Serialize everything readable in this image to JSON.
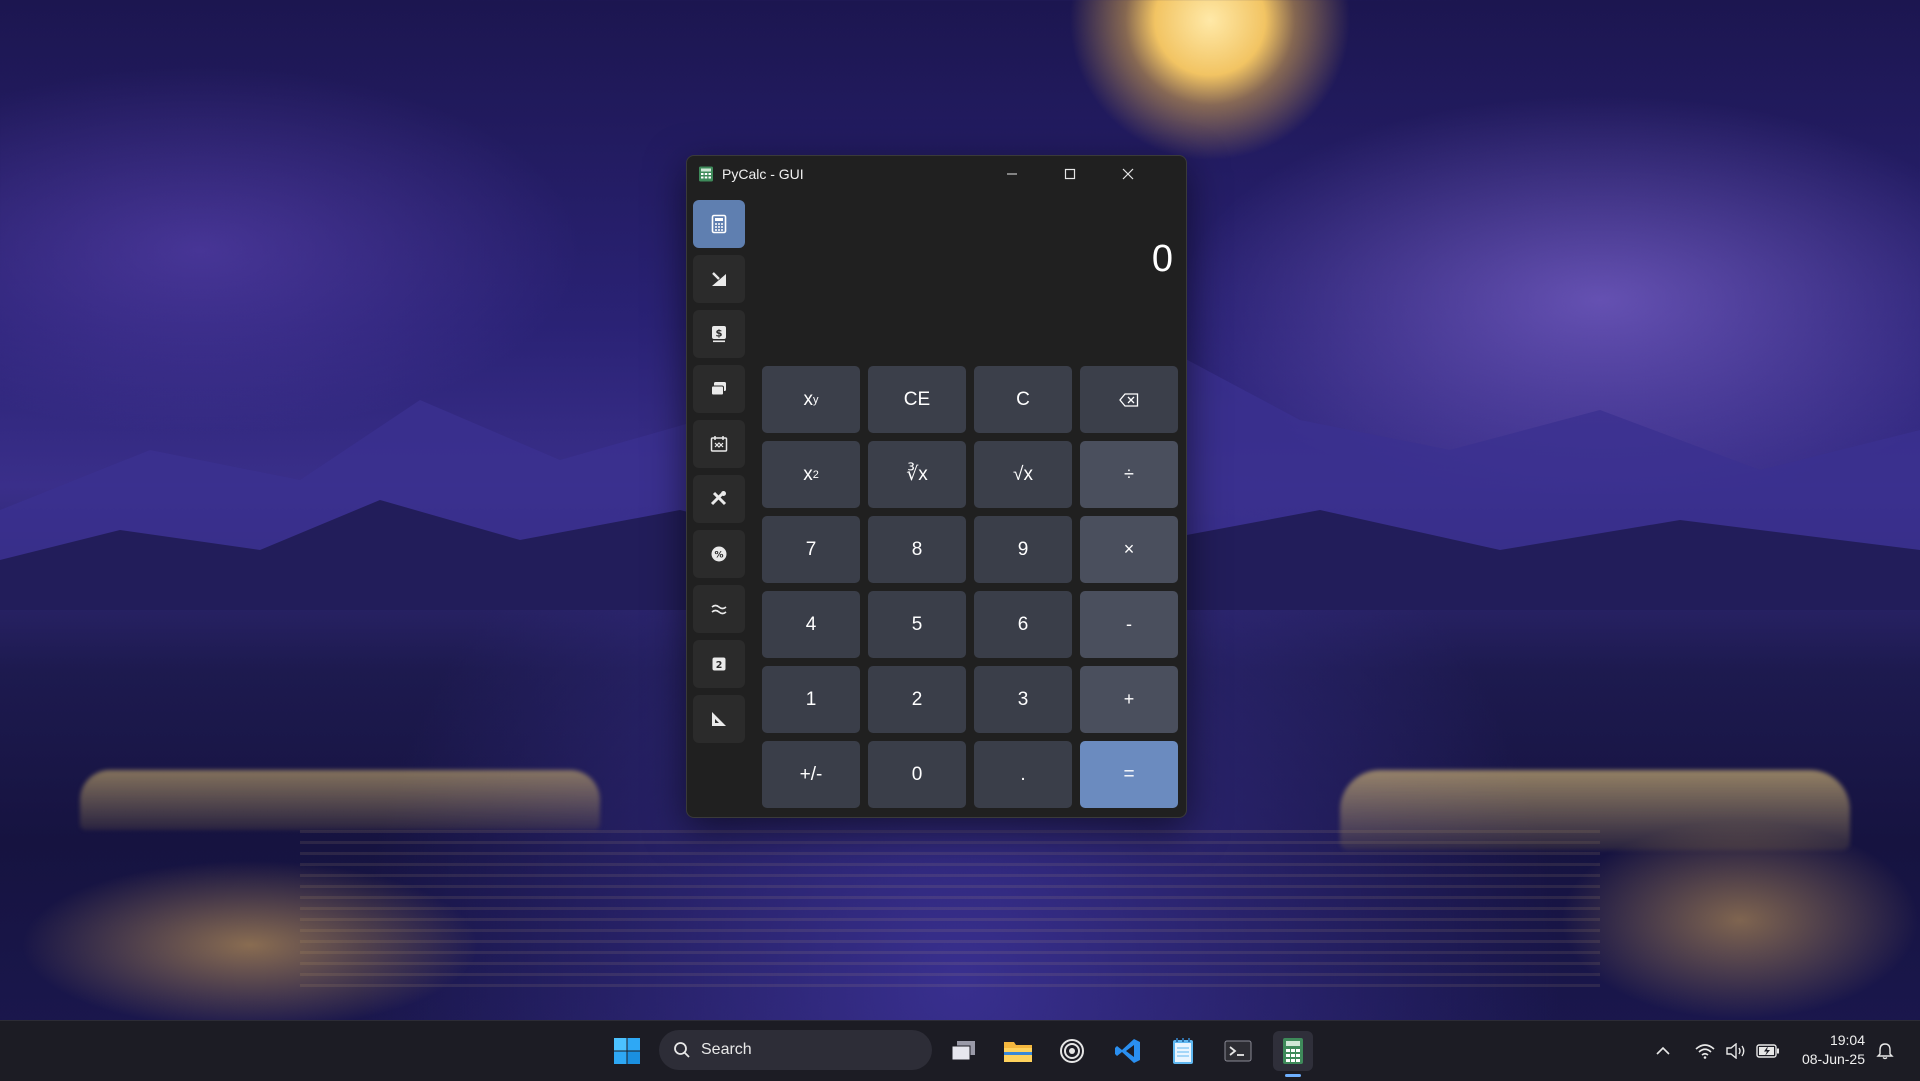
{
  "window": {
    "title": "PyCalc - GUI",
    "controls": {
      "minimize": "minimize",
      "maximize": "maximize",
      "close": "close"
    }
  },
  "sidebar": {
    "items": [
      {
        "name": "standard-calculator",
        "icon": "calculator-icon",
        "active": true
      },
      {
        "name": "scientific",
        "icon": "pencil-ruler-icon",
        "active": false
      },
      {
        "name": "currency",
        "icon": "dollar-icon",
        "active": false
      },
      {
        "name": "converter",
        "icon": "stack-icon",
        "active": false
      },
      {
        "name": "date",
        "icon": "calendar-icon",
        "active": false
      },
      {
        "name": "tools",
        "icon": "tools-icon",
        "active": false
      },
      {
        "name": "percentage",
        "icon": "percent-gear-icon",
        "active": false
      },
      {
        "name": "approximation",
        "icon": "approx-icon",
        "active": false
      },
      {
        "name": "base",
        "icon": "number-box-icon",
        "active": false
      },
      {
        "name": "geometry",
        "icon": "triangle-ruler-icon",
        "active": false
      }
    ]
  },
  "display": {
    "value": "0"
  },
  "keypad": {
    "rows": [
      [
        "xʸ",
        "CE",
        "C",
        "⌫"
      ],
      [
        "x²",
        "∛x",
        "√x",
        "÷"
      ],
      [
        "7",
        "8",
        "9",
        "×"
      ],
      [
        "4",
        "5",
        "6",
        "-"
      ],
      [
        "1",
        "2",
        "3",
        "+"
      ],
      [
        "+/-",
        "0",
        ".",
        "="
      ]
    ]
  },
  "taskbar": {
    "search_placeholder": "Search",
    "apps": [
      "start-icon",
      "task-view-icon",
      "file-explorer-icon",
      "copilot-icon",
      "vscode-icon",
      "notepad-icon",
      "terminal-icon",
      "pycalc-icon"
    ],
    "active_app": "pycalc-icon",
    "time": "19:04",
    "date": "08-Jun-25"
  },
  "colors": {
    "accent": "#6b8bbf",
    "sidebar_active": "#5f7fb0",
    "window_bg": "#202020",
    "key_bg": "#3b3f4a"
  }
}
